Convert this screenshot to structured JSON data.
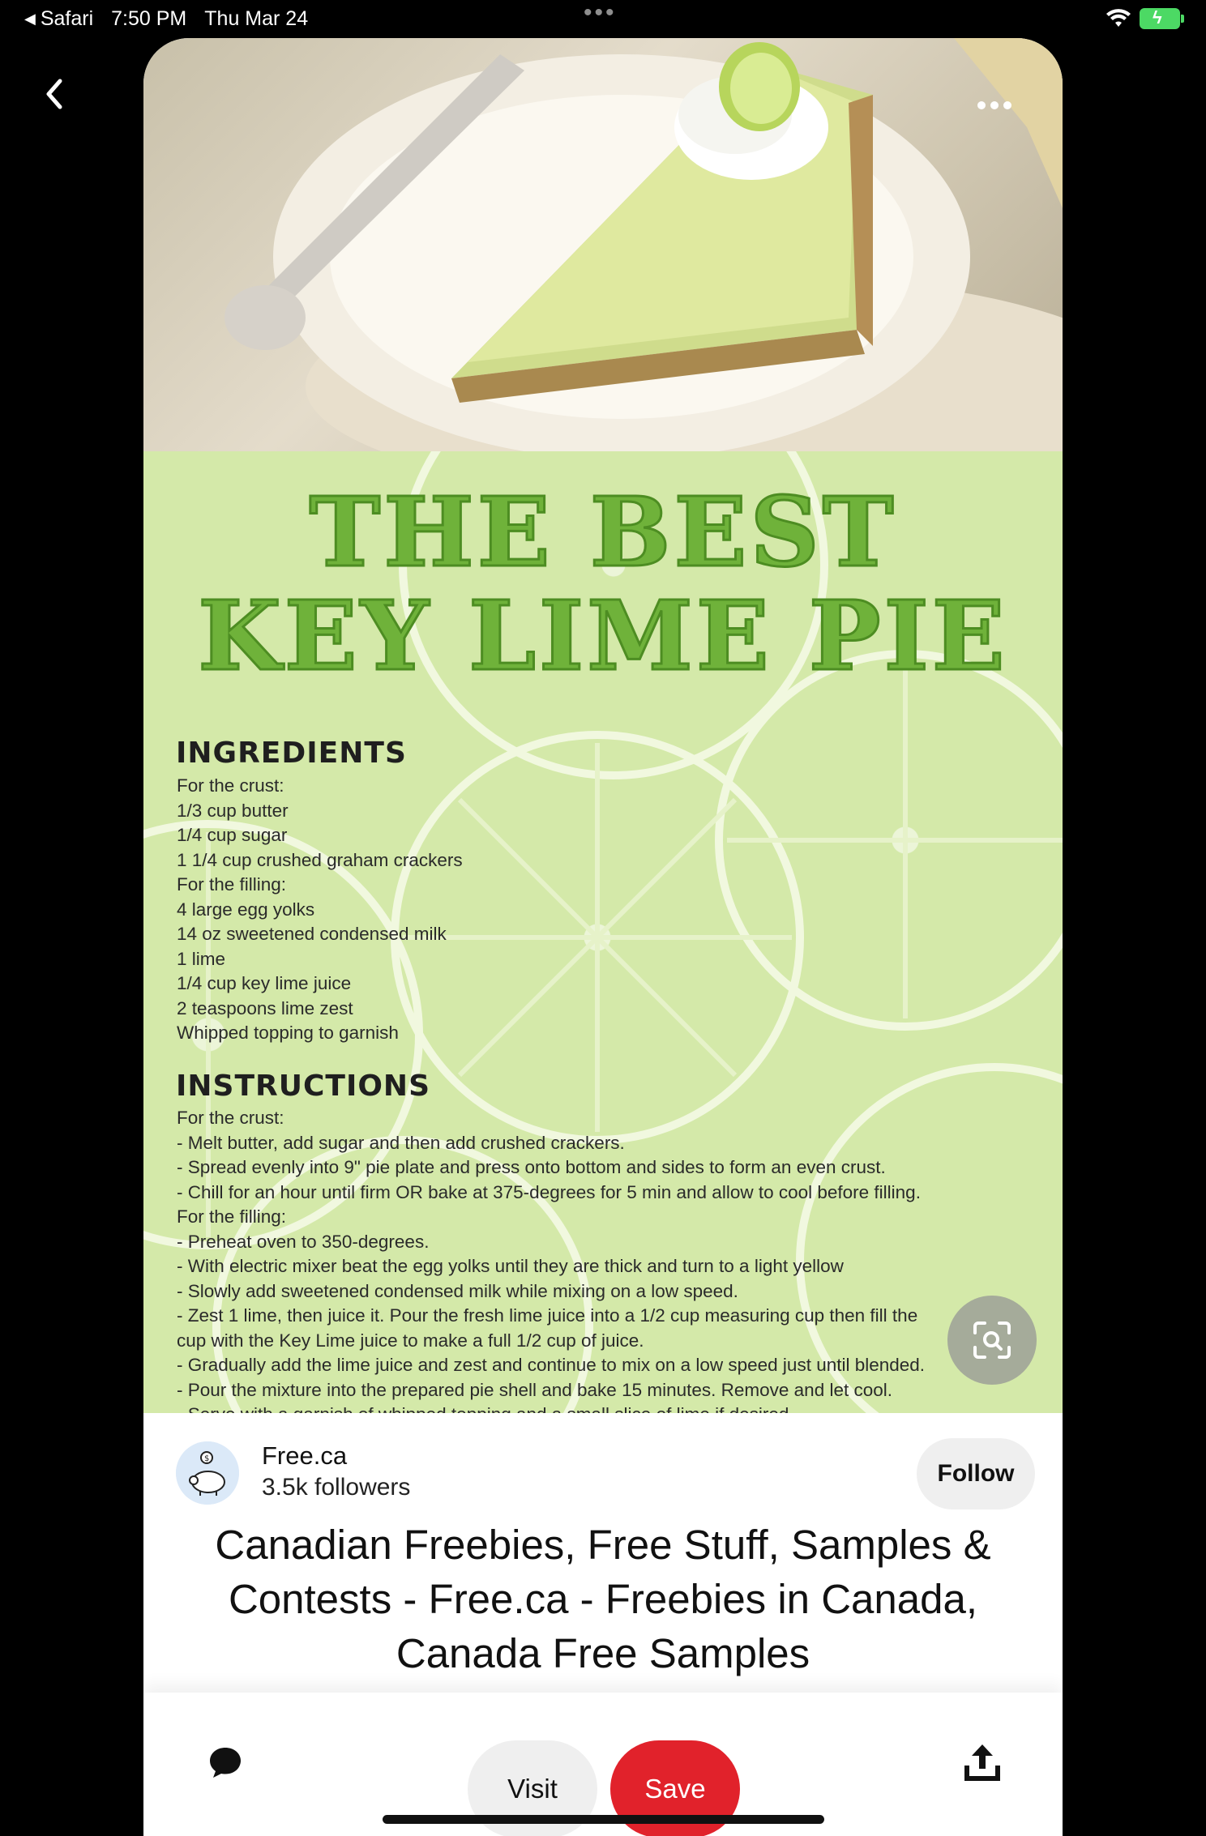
{
  "status_bar": {
    "back_app": "Safari",
    "time": "7:50 PM",
    "date": "Thu Mar 24"
  },
  "icons": {
    "back": "chevron-left-icon",
    "more": "ellipsis-icon",
    "visual_search": "visual-search-icon",
    "comment": "comment-bubble-icon",
    "share": "share-upload-icon",
    "wifi": "wifi-icon",
    "battery": "battery-charging-icon"
  },
  "recipe": {
    "title_line1": "THE BEST",
    "title_line2": "KEY LIME PIE",
    "ingredients_heading": "INGREDIENTS",
    "ingredients": [
      "For the crust:",
      "1/3 cup butter",
      "1/4 cup sugar",
      "1 1/4 cup crushed graham crackers",
      "For the filling:",
      "4 large egg yolks",
      "14 oz sweetened condensed milk",
      "1 lime",
      "1/4 cup key lime juice",
      "2 teaspoons lime zest",
      "Whipped topping to garnish"
    ],
    "instructions_heading": "INSTRUCTIONS",
    "instructions": [
      "For the crust:",
      "- Melt butter, add sugar and then add crushed crackers.",
      "- Spread evenly into 9\" pie plate and press onto bottom and sides to form an even crust.",
      "- Chill for an hour until firm OR bake at 375-degrees for 5 min and allow to cool before filling.",
      "For the filling:",
      "- Preheat oven to 350-degrees.",
      "- With electric mixer beat the egg yolks until they are thick and turn to a light yellow",
      "- Slowly add sweetened condensed milk while mixing on a low speed.",
      "- Zest 1 lime, then juice it. Pour the fresh lime juice into a 1/2 cup measuring cup then fill the",
      "cup with the Key Lime juice to make a full 1/2 cup of juice.",
      "- Gradually add the lime juice and zest and continue to mix on a low speed just until blended.",
      "- Pour the mixture into the prepared pie shell and bake 15 minutes. Remove and let cool.",
      "- Serve with a garnish of whipped topping and a small slice of lime if desired."
    ]
  },
  "creator": {
    "name": "Free.ca",
    "followers": "3.5k followers",
    "follow_label": "Follow"
  },
  "pin": {
    "title": "Canadian Freebies, Free Stuff, Samples & Contests - Free.ca - Freebies in Canada, Canada Free Samples"
  },
  "actions": {
    "visit_label": "Visit",
    "save_label": "Save"
  },
  "colors": {
    "save_red": "#e1222b",
    "lime_green": "#6fb23a",
    "battery_green": "#4cd964"
  }
}
